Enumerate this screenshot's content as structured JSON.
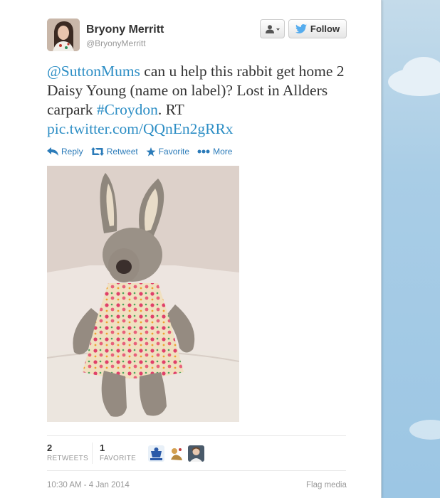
{
  "author": {
    "name": "Bryony Merritt",
    "handle": "@BryonyMerritt"
  },
  "buttons": {
    "follow_label": "Follow"
  },
  "tweet": {
    "mention": "@SuttonMums",
    "text_1": " can u help this rabbit get home 2 Daisy Young (name on label)? Lost in Allders carpark ",
    "hashtag": "#Croydon",
    "text_2": ". RT ",
    "link": "pic.twitter.com/QQnEn2gRRx"
  },
  "actions": {
    "reply": "Reply",
    "retweet": "Retweet",
    "favorite": "Favorite",
    "more": "More"
  },
  "stats": {
    "retweets_count": "2",
    "retweets_label": "RETWEETS",
    "favorites_count": "1",
    "favorites_label": "FAVORITE"
  },
  "footer": {
    "timestamp": "10:30 AM - 4 Jan 2014",
    "flag": "Flag media"
  },
  "colors": {
    "link": "#2d8ec5",
    "action": "#2b7bb9",
    "background": "#a9cde6"
  },
  "icons": [
    "person-icon",
    "twitter-bird-icon",
    "reply-icon",
    "retweet-icon",
    "star-icon",
    "more-dots-icon"
  ]
}
